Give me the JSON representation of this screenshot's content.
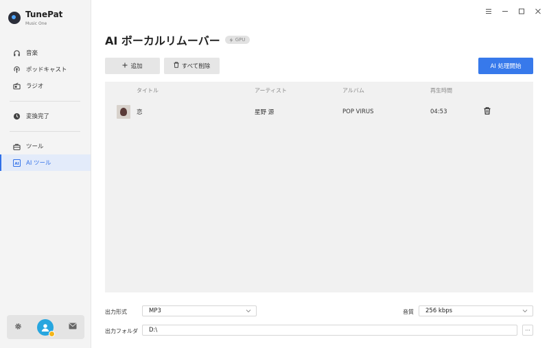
{
  "app": {
    "name": "TunePat",
    "subtitle": "Music One"
  },
  "sidebar": {
    "items": [
      {
        "label": "音楽",
        "icon": "headphones-icon"
      },
      {
        "label": "ポッドキャスト",
        "icon": "podcast-icon"
      },
      {
        "label": "ラジオ",
        "icon": "radio-icon"
      },
      {
        "label": "変換完了",
        "icon": "clock-icon"
      },
      {
        "label": "ツール",
        "icon": "toolbox-icon"
      },
      {
        "label": "AI ツール",
        "icon": "ai-icon",
        "active": true
      }
    ]
  },
  "page": {
    "title": "AI ボーカルリムーバー",
    "gpu_badge": "GPU"
  },
  "toolbar": {
    "add_label": "追加",
    "delete_all_label": "すべて削除",
    "start_label": "AI 処理開始"
  },
  "table": {
    "headers": {
      "title": "タイトル",
      "artist": "アーティスト",
      "album": "アルバム",
      "duration": "再生時間"
    },
    "rows": [
      {
        "title": "恋",
        "artist": "星野 源",
        "album": "POP VIRUS",
        "duration": "04:53"
      }
    ]
  },
  "settings": {
    "format_label": "出力形式",
    "format_value": "MP3",
    "quality_label": "音質",
    "quality_value": "256 kbps",
    "folder_label": "出力フォルダ",
    "folder_value": "D:\\",
    "browse_label": "···"
  },
  "colors": {
    "accent": "#3779eb",
    "sidebar_bg": "#f4f4f4",
    "panel_bg": "#f1f1f1"
  }
}
